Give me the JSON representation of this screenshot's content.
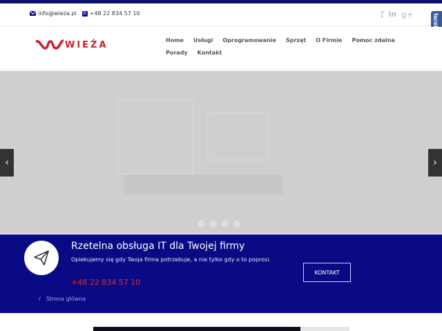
{
  "topbar": {
    "email": "info@wieza.pl",
    "phone": "+48 22 834 57 10",
    "social": [
      "f",
      "in",
      "g+"
    ]
  },
  "facebook_tab": {
    "label": "facebook"
  },
  "logo": {
    "text": "WIEŻA"
  },
  "nav": {
    "items": [
      "Home",
      "Usługi",
      "Oprogramowanie",
      "Sprzęt",
      "O Firmie",
      "Pomoc zdalna",
      "Porady",
      "Kontakt"
    ]
  },
  "slider": {
    "prev_glyph": "‹",
    "next_glyph": "›",
    "dot_count": 4
  },
  "cta": {
    "title": "Rzetelna obsługa IT dla Twojej firmy",
    "subtitle": "Opiekujemy się gdy Twoja firma potrzebuje, a nie tylko gdy o to poprosi.",
    "phone": "+48 22 834 57 10",
    "button": "KONTAKT",
    "breadcrumb_sep": "/",
    "breadcrumb": "Strona główna"
  },
  "colors": {
    "brand_red": "#cc1e2b",
    "navy": "#0a0a84",
    "facebook": "#3b5998"
  }
}
